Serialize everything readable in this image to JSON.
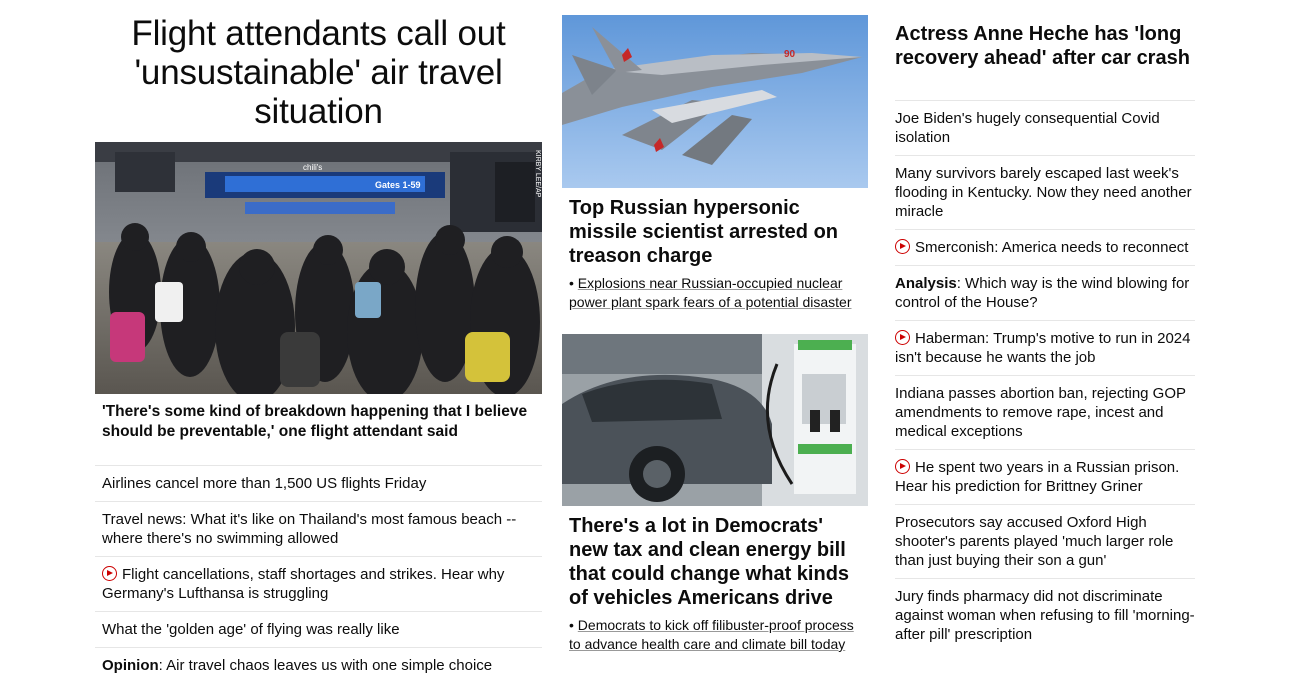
{
  "left": {
    "headline": "Flight attendants call out 'unsustainable' air travel situation",
    "hero_credit": "KIRBY LEE/AP",
    "hero_sign": "Gates 1-59",
    "hero_sign_brand": "chili's",
    "hero_caption": "'There's some kind of breakdown happening that I believe should be preventable,' one flight attendant said",
    "items": [
      {
        "text": "Airlines cancel more than 1,500 US flights Friday"
      },
      {
        "text": "Travel news: What it's like on Thailand's most famous beach -- where there's no swimming allowed"
      },
      {
        "text": "Flight cancellations, staff shortages and strikes. Hear why Germany's Lufthansa is struggling",
        "video": true
      },
      {
        "text": "What the 'golden age' of flying was really like"
      },
      {
        "prefix": "Opinion",
        "text": ": Air travel chaos leaves us with one simple choice"
      }
    ]
  },
  "middle": {
    "card1": {
      "tail_number": "90",
      "title": "Top Russian hypersonic missile scientist arrested on treason charge",
      "sub": "Explosions near Russian-occupied nuclear power plant spark fears of a potential disaster"
    },
    "card2": {
      "title": "There's a lot in Democrats' new tax and clean energy bill that could change what kinds of vehicles Americans drive",
      "sub": "Democrats to kick off filibuster-proof process to advance health care and climate bill today"
    }
  },
  "right": {
    "headline": "Actress Anne Heche has 'long recovery ahead' after car crash",
    "items": [
      {
        "text": "Joe Biden's hugely consequential Covid isolation"
      },
      {
        "text": "Many survivors barely escaped last week's flooding in Kentucky. Now they need another miracle"
      },
      {
        "text": "Smerconish: America needs to reconnect",
        "video": true
      },
      {
        "prefix": "Analysis",
        "text": ": Which way is the wind blowing for control of the House?"
      },
      {
        "text": "Haberman: Trump's motive to run in 2024 isn't because he wants the job",
        "video": true
      },
      {
        "text": "Indiana passes abortion ban, rejecting GOP amendments to remove rape, incest and medical exceptions"
      },
      {
        "text": "He spent two years in a Russian prison. Hear his prediction for Brittney Griner",
        "video": true
      },
      {
        "text": "Prosecutors say accused Oxford High shooter's parents played 'much larger role than just buying their son a gun'"
      },
      {
        "text": "Jury finds pharmacy did not discriminate against woman when refusing to fill 'morning-after pill' prescription"
      }
    ]
  },
  "icons": {
    "video": "play-circle-icon"
  },
  "colors": {
    "accent": "#cc0000",
    "text": "#0c0c0c",
    "divider": "#e6e6e6"
  }
}
